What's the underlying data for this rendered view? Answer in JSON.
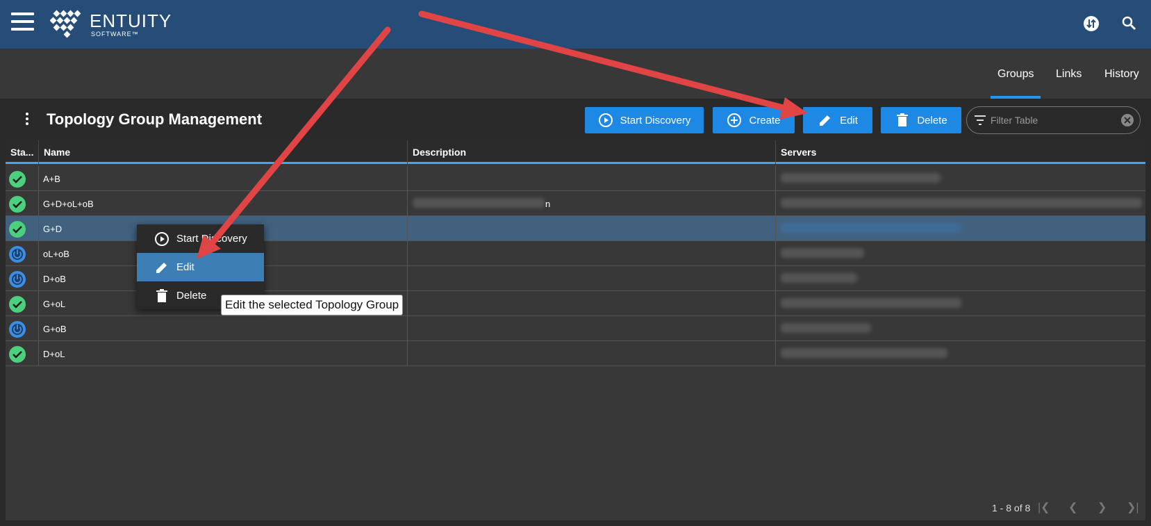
{
  "brand": {
    "name": "ENTUITY",
    "sub": "SOFTWARE™"
  },
  "topbar": {
    "icons": [
      "sync-icon",
      "search-icon"
    ]
  },
  "tabs": [
    {
      "label": "Groups",
      "active": true
    },
    {
      "label": "Links",
      "active": false
    },
    {
      "label": "History",
      "active": false
    }
  ],
  "panel": {
    "title": "Topology Group Management",
    "buttons": {
      "start_discovery": "Start Discovery",
      "create": "Create",
      "edit": "Edit",
      "delete": "Delete"
    },
    "filter_placeholder": "Filter Table"
  },
  "table": {
    "headers": [
      "Sta...",
      "Name",
      "Description",
      "Servers"
    ],
    "rows": [
      {
        "status": "ok",
        "name": "A+B",
        "description": "",
        "description_trailing": "",
        "servers_redacted": true
      },
      {
        "status": "ok",
        "name": "G+D+oL+oB",
        "description": "[redacted]",
        "description_trailing": "n",
        "servers_redacted": true
      },
      {
        "status": "ok",
        "name": "G+D",
        "description": "",
        "description_trailing": "",
        "servers_redacted": true,
        "selected": true
      },
      {
        "status": "power",
        "name": "oL+oB",
        "description": "",
        "description_trailing": "",
        "servers_redacted": true
      },
      {
        "status": "power",
        "name": "D+oB",
        "description": "",
        "description_trailing": "",
        "servers_redacted": true
      },
      {
        "status": "ok",
        "name": "G+oL",
        "description": "",
        "description_trailing": "",
        "servers_redacted": true
      },
      {
        "status": "power",
        "name": "G+oB",
        "description": "",
        "description_trailing": "",
        "servers_redacted": true
      },
      {
        "status": "ok",
        "name": "D+oL",
        "description": "",
        "description_trailing": "",
        "servers_redacted": true
      }
    ],
    "pagination": "1 - 8 of 8"
  },
  "context_menu": {
    "items": [
      {
        "label": "Start Discovery",
        "icon": "play-circle-icon"
      },
      {
        "label": "Edit",
        "icon": "pencil-icon",
        "highlighted": true
      },
      {
        "label": "Delete",
        "icon": "trash-icon"
      }
    ],
    "tooltip": "Edit the selected Topology Group"
  },
  "colors": {
    "topbar": "#254d78",
    "accent_button": "#1e88e5",
    "status_ok": "#4cd07d",
    "status_power": "#3a8ee6",
    "annotation_arrow": "#e04444"
  }
}
